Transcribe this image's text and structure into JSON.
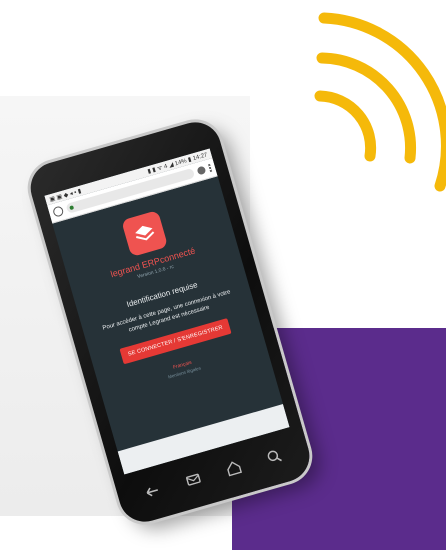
{
  "colors": {
    "purple": "#5b2c8c",
    "wifi": "#f5b90a",
    "accent_red": "#e53935",
    "screen_bg": "#263238"
  },
  "phone": {
    "status_bar": {
      "left_icons": "▣ ▣ ◆ ◂ ▪ ▮",
      "right_text": "▮ ▮ ᯤ 4 ◢ 14% ▮ 14:27"
    },
    "browser": {
      "home_icon": "home-icon",
      "secure_icon": "lock-icon",
      "menu_icon": "kebab-menu-icon"
    },
    "app": {
      "logo_icon": "layers-icon",
      "name": "legrand ERPconnecté",
      "version": "Version 1.0.6 - rc",
      "ident_title": "Identification requise",
      "message": "Pour accéder à cette page, une connexion à votre compte Legrand est nécessaire",
      "connect_button": "SE CONNECTER / S'ENREGISTRER",
      "language_link": "Français",
      "legal": "Mentions légales"
    },
    "nav_icons": [
      "back-icon",
      "mail-icon",
      "home-icon",
      "search-icon"
    ]
  }
}
